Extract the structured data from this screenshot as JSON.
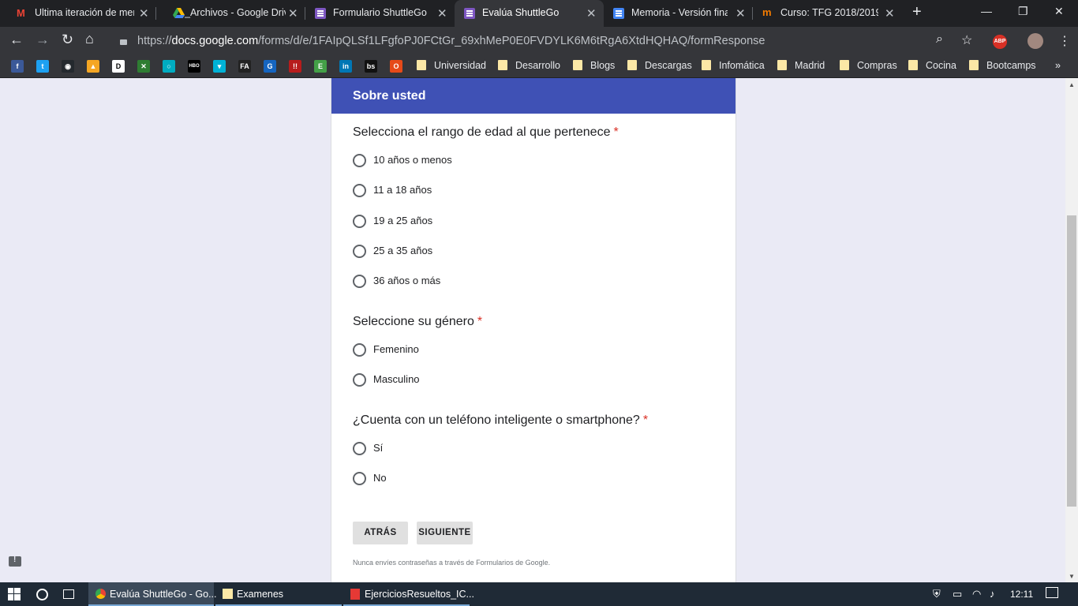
{
  "browser": {
    "tabs": [
      {
        "title": "Ultima iteración de mer",
        "active": false
      },
      {
        "title": "_Archivos - Google Driv",
        "active": false
      },
      {
        "title": "Formulario ShuttleGo -",
        "active": false
      },
      {
        "title": "Evalúa ShuttleGo",
        "active": true
      },
      {
        "title": "Memoria - Versión final",
        "active": false
      },
      {
        "title": "Curso: TFG 2018/2019 -",
        "active": false
      }
    ],
    "url_scheme": "https://",
    "url_host": "docs.google.com",
    "url_path": "/forms/d/e/1FAIpQLSf1LFgfoPJ0FCtGr_69xhMeP0E0FVDYLK6M6tRgA6XtdHQHAQ/formResponse",
    "adblock_label": "ABP",
    "bookmark_icons": [
      {
        "name": "facebook",
        "text": "f",
        "color": "#3b5998"
      },
      {
        "name": "twitter",
        "text": "t",
        "color": "#1da1f2"
      },
      {
        "name": "github",
        "text": "◉",
        "color": "#24292e"
      },
      {
        "name": "firebase",
        "text": "▲",
        "color": "#f5a623"
      },
      {
        "name": "dev",
        "text": "D",
        "color": "#ffffff"
      },
      {
        "name": "crossover",
        "text": "✕",
        "color": "#2e7d32"
      },
      {
        "name": "circle",
        "text": "○",
        "color": "#00acc1"
      },
      {
        "name": "hbo",
        "text": "HBO",
        "color": "#000000"
      },
      {
        "name": "wuaki",
        "text": "▾",
        "color": "#00b2d6"
      },
      {
        "name": "filmaffinity",
        "text": "FA",
        "color": "#222222"
      },
      {
        "name": "gc",
        "text": "G",
        "color": "#1565c0"
      },
      {
        "name": "tt",
        "text": "!!",
        "color": "#b71c1c"
      },
      {
        "name": "evernote",
        "text": "E",
        "color": "#43a047"
      },
      {
        "name": "linkedin",
        "text": "in",
        "color": "#0077b5"
      },
      {
        "name": "bs",
        "text": "bs",
        "color": "#111111"
      },
      {
        "name": "office",
        "text": "O",
        "color": "#e64a19"
      }
    ],
    "bookmark_folders": [
      "Universidad",
      "Desarrollo",
      "Blogs",
      "Descargas",
      "Infomática",
      "Madrid",
      "Compras",
      "Cocina",
      "Bootcamps"
    ]
  },
  "form": {
    "section_title": "Sobre usted",
    "required_mark": "*",
    "questions": [
      {
        "title": "Selecciona el rango de edad al que pertenece",
        "options": [
          "10 años o menos",
          "11 a 18 años",
          "19 a 25 años",
          "25 a 35 años",
          "36 años o más"
        ]
      },
      {
        "title": "Seleccione su género",
        "options": [
          "Femenino",
          "Masculino"
        ]
      },
      {
        "title": "¿Cuenta con un teléfono inteligente o smartphone?",
        "options": [
          "Sí",
          "No"
        ]
      }
    ],
    "back_button": "ATRÁS",
    "next_button": "SIGUIENTE",
    "footer_note": "Nunca envíes contraseñas a través de Formularios de Google."
  },
  "taskbar": {
    "items": [
      "Evalúa ShuttleGo - Go...",
      "Examenes",
      "EjerciciosResueltos_IC..."
    ],
    "time": "12:11"
  },
  "colors": {
    "section_header": "#3f51b5",
    "required": "#d93025",
    "page_background": "#eaeaf5"
  }
}
